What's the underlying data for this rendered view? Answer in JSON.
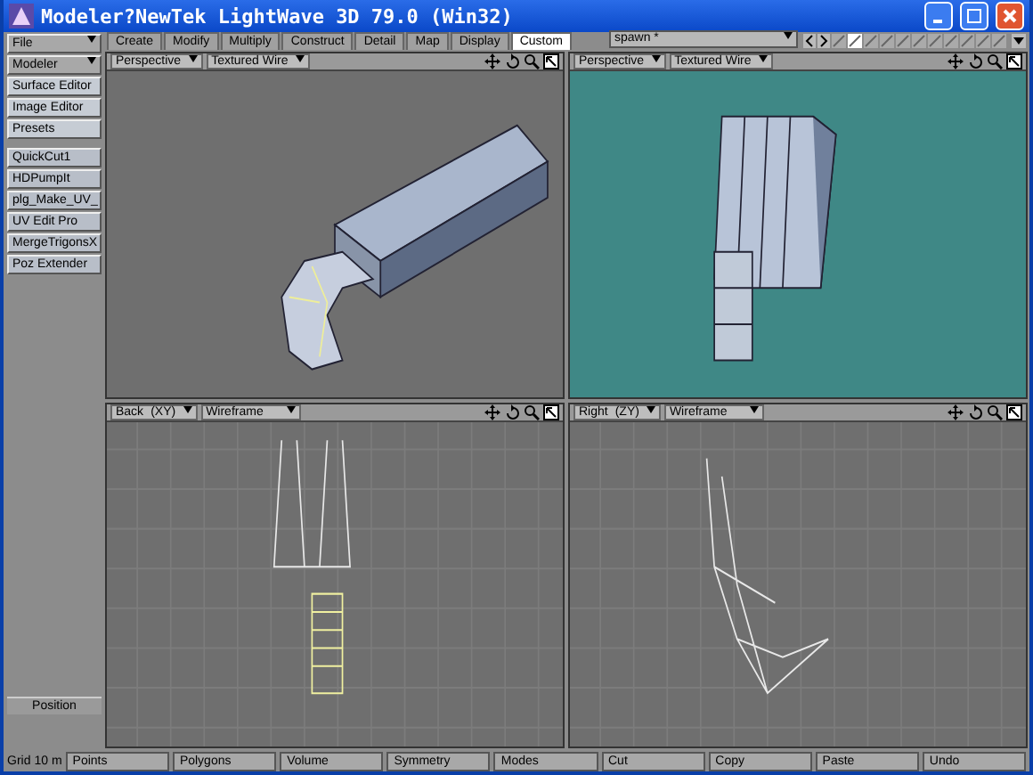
{
  "window": {
    "title": "Modeler?NewTek LightWave 3D 79.0 (Win32)"
  },
  "sidebar": {
    "menus": [
      "File",
      "Modeler"
    ],
    "button_groups": [
      [
        "Surface Editor",
        "Image Editor",
        "Presets"
      ],
      [
        "QuickCut1",
        "HDPumpIt",
        "plg_Make_UV_",
        "UV Edit Pro",
        "MergeTrigonsX",
        "Poz Extender"
      ]
    ],
    "position": "Position"
  },
  "tabs": [
    {
      "label": "Create",
      "selected": false
    },
    {
      "label": "Modify",
      "selected": false
    },
    {
      "label": "Multiply",
      "selected": false
    },
    {
      "label": "Construct",
      "selected": false
    },
    {
      "label": "Detail",
      "selected": false
    },
    {
      "label": "Map",
      "selected": false
    },
    {
      "label": "Display",
      "selected": false
    },
    {
      "label": "Custom",
      "selected": true
    }
  ],
  "layer_select": "spawn *",
  "viewports": [
    {
      "view": "Perspective",
      "mode": "Textured Wire",
      "kind": "perspective-a",
      "color": "#6f6f6f"
    },
    {
      "view": "Perspective",
      "mode": "Textured Wire",
      "kind": "perspective-b",
      "color": "#3f8886"
    },
    {
      "view": "Back",
      "axis": "(XY)",
      "mode": "Wireframe",
      "kind": "back",
      "color": "#6f6f6f"
    },
    {
      "view": "Right",
      "axis": "(ZY)",
      "mode": "Wireframe",
      "kind": "right",
      "color": "#6f6f6f"
    }
  ],
  "bottom_bar": {
    "grid_label": "Grid",
    "grid_value": "10 m",
    "items": [
      "Points",
      "Polygons",
      "Volume",
      "Symmetry",
      "Modes",
      "Cut",
      "Copy",
      "Paste",
      "Undo"
    ]
  }
}
